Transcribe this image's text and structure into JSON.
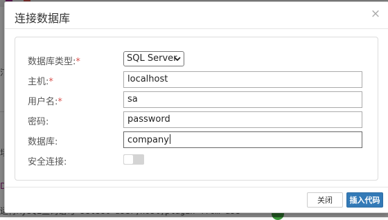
{
  "dialog": {
    "title": "连接数据库",
    "close_symbol": "×"
  },
  "form": {
    "db_type": {
      "label": "数据库类型:",
      "required_mark": "*",
      "value": "SQL Server"
    },
    "host": {
      "label": "主机:",
      "required_mark": "*",
      "value": "localhost"
    },
    "username": {
      "label": "用户名:",
      "required_mark": "*",
      "value": "sa"
    },
    "password": {
      "label": "密码:",
      "value": "password"
    },
    "database": {
      "label": "数据库:",
      "value": "company"
    },
    "secure": {
      "label": "安全连接:",
      "on": false
    }
  },
  "footer": {
    "close_label": "关闭",
    "insert_label": "插入代码"
  },
  "background": {
    "code_line": "运行MySQL查询语句 select user,host,plugin from use",
    "left_snippets": [
      "汀",
      "场",
      "D"
    ],
    "right_snippets": [
      "}",
      "}"
    ]
  },
  "colors": {
    "primary": "#337ab7",
    "required": "#d9534f"
  }
}
